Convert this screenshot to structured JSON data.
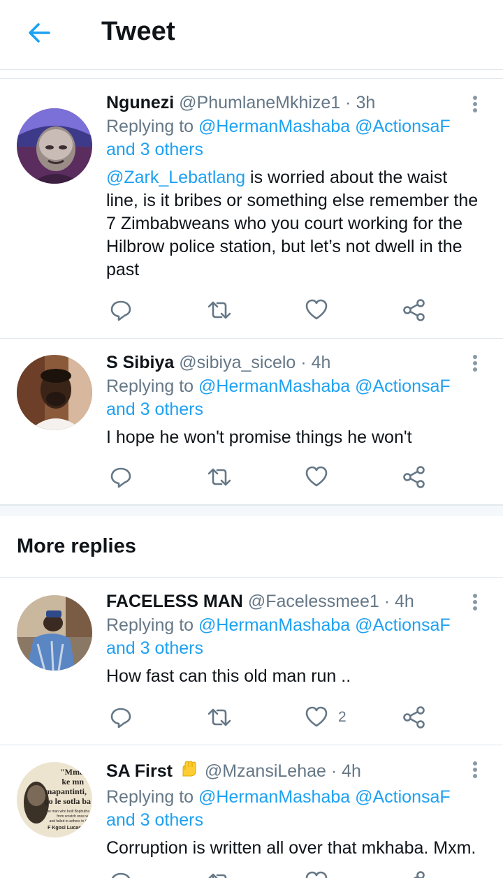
{
  "header": {
    "title": "Tweet",
    "back_icon": "arrow-left-icon"
  },
  "colors": {
    "accent": "#1da1f2",
    "secondary_text": "#657786",
    "divider": "#e1e8ed",
    "badge": "#ffcc33"
  },
  "section_title": "More replies",
  "tweets": [
    {
      "name": "Ngunezi",
      "handle": "@PhumlaneMkhize1",
      "time": "· 3h",
      "replying_prefix": "Replying to",
      "replying_mentions": "@HermanMashaba @ActionsaF",
      "replying_others": "and 3 others",
      "text_mention": "@Zark_Lebatlang",
      "text": " is worried about the waist line, is it bribes or something else remember the 7 Zimbabweans who you court working for the Hilbrow police station, but let’s not dwell in the past",
      "likes": ""
    },
    {
      "name": "S Sibiya",
      "handle": "@sibiya_sicelo",
      "time": "· 4h",
      "replying_prefix": "Replying to",
      "replying_mentions": "@HermanMashaba @ActionsaF",
      "replying_others": "and 3 others",
      "text": "I hope he won't promise things he won't",
      "likes": ""
    },
    {
      "name": "FACELESS MAN",
      "handle": "@Facelessmee1",
      "time": "· 4h",
      "replying_prefix": "Replying to",
      "replying_mentions": "@HermanMashaba @ActionsaF",
      "replying_others": "and 3 others",
      "text": "How fast can this old man run ..",
      "likes": "2"
    },
    {
      "name": "SA First",
      "badge_icon": "raised-fist-emoji",
      "handle": "@MzansiLehae",
      "time": "· 4h",
      "replying_prefix": "Replying to",
      "replying_mentions": "@HermanMashaba @ActionsaF",
      "replying_others": "and 3 others",
      "text": "Corruption is written all over that mkhaba. Mxm.",
      "likes": "",
      "avatar_text": [
        "\"Mma",
        "ke mn",
        "mapantinti,",
        "go le sotla ba",
        "The man who built Bophutha",
        "from scratch once w",
        "and failed to adhere to th",
        "F Kgosi Lucas"
      ]
    }
  ]
}
